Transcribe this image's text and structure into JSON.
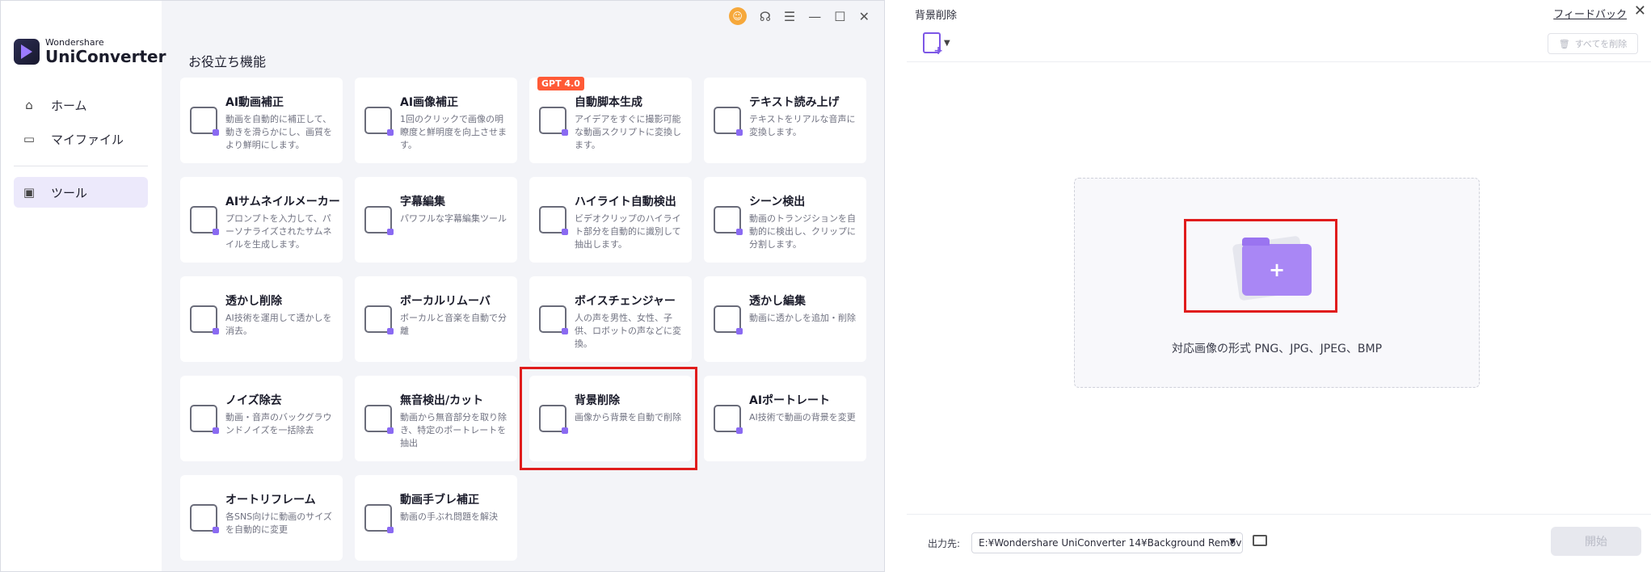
{
  "app": {
    "brand_small": "Wondershare",
    "brand_name": "UniConverter"
  },
  "sidebar": {
    "items": [
      {
        "label": "ホーム",
        "icon": "home-icon"
      },
      {
        "label": "マイファイル",
        "icon": "folder-icon"
      },
      {
        "label": "ツール",
        "icon": "toolbox-icon",
        "active": true
      }
    ]
  },
  "titlebar": {
    "icons": [
      "avatar-icon",
      "headset-icon",
      "menu-icon",
      "minimize-icon",
      "maximize-icon",
      "close-icon"
    ]
  },
  "section_title": "お役立ち機能",
  "tools": [
    {
      "title": "AI動画補正",
      "desc": "動画を自動的に補正して、動きを滑らかにし、画質をより鮮明にします。"
    },
    {
      "title": "AI画像補正",
      "desc": "1回のクリックで画像の明瞭度と鮮明度を向上させます。"
    },
    {
      "title": "自動脚本生成",
      "desc": "アイデアをすぐに撮影可能な動画スクリプトに変換します。",
      "badge": "GPT 4.0"
    },
    {
      "title": "テキスト読み上げ",
      "desc": "テキストをリアルな音声に変換します。"
    },
    {
      "title": "AIサムネイルメーカー",
      "desc": "プロンプトを入力して、パーソナライズされたサムネイルを生成します。"
    },
    {
      "title": "字幕編集",
      "desc": "パワフルな字幕編集ツール"
    },
    {
      "title": "ハイライト自動検出",
      "desc": "ビデオクリップのハイライト部分を自動的に識別して抽出します。"
    },
    {
      "title": "シーン検出",
      "desc": "動画のトランジションを自動的に検出し、クリップに分割します。"
    },
    {
      "title": "透かし削除",
      "desc": "AI技術を運用して透かしを消去。"
    },
    {
      "title": "ボーカルリムーバ",
      "desc": "ボーカルと音楽を自動で分離"
    },
    {
      "title": "ボイスチェンジャー",
      "desc": "人の声を男性、女性、子供、ロボットの声などに変換。"
    },
    {
      "title": "透かし編集",
      "desc": "動画に透かしを追加・削除"
    },
    {
      "title": "ノイズ除去",
      "desc": "動画・音声のバックグラウンドノイズを一括除去"
    },
    {
      "title": "無音検出/カット",
      "desc": "動画から無音部分を取り除き、特定のポートレートを抽出"
    },
    {
      "title": "背景削除",
      "desc": "画像から背景を自動で削除"
    },
    {
      "title": "AIポートレート",
      "desc": "AI技術で動画の背景を変更"
    },
    {
      "title": "オートリフレーム",
      "desc": "各SNS向けに動画のサイズを自動的に変更"
    },
    {
      "title": "動画手ブレ補正",
      "desc": "動画の手ぶれ問題を解決"
    }
  ],
  "panel": {
    "title": "背景削除",
    "feedback": "フィードバック",
    "delete_all": "すべてを削除",
    "dropzone_text": "対応画像の形式 PNG、JPG、JPEG、BMP",
    "output_label": "出力先:",
    "output_path": "E:¥Wondershare UniConverter 14¥Background Remove",
    "start": "開始"
  },
  "colors": {
    "accent": "#8a6af2",
    "highlight": "#e01c1c",
    "badge": "#ff5a36"
  }
}
